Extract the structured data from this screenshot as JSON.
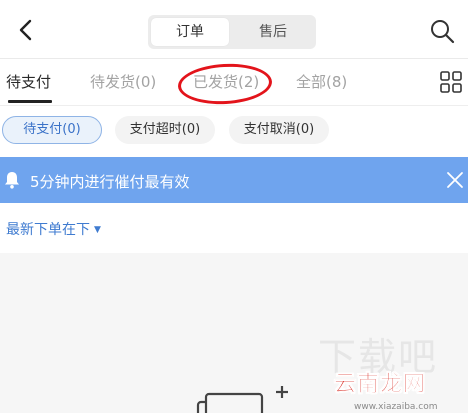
{
  "header": {
    "segments": [
      "订单",
      "售后"
    ],
    "back_icon": "chevron-left-icon",
    "search_icon": "search-icon"
  },
  "tabs": [
    {
      "label": "待支付",
      "active": true
    },
    {
      "label": "待发货(0)",
      "active": false
    },
    {
      "label": "已发货(2)",
      "active": false
    },
    {
      "label": "全部(8)",
      "active": false
    }
  ],
  "tabs_more_icon": "grid-icon",
  "chips": [
    {
      "label": "待支付(0)",
      "active": true
    },
    {
      "label": "支付超时(0)",
      "active": false
    },
    {
      "label": "支付取消(0)",
      "active": false
    }
  ],
  "notice": {
    "icon": "bell-icon",
    "text": "5分钟内进行催付最有效",
    "close_icon": "close-icon"
  },
  "sort": {
    "label": "最新下单在下",
    "caret": "▼"
  },
  "watermark": {
    "ghost": "下载吧",
    "logo": "云南龙网",
    "url": "www.xiazaiba.com"
  },
  "colors": {
    "accent": "#3f7bd0",
    "notice_bg": "#6fa4ee",
    "annotation_circle": "#e3141b"
  }
}
